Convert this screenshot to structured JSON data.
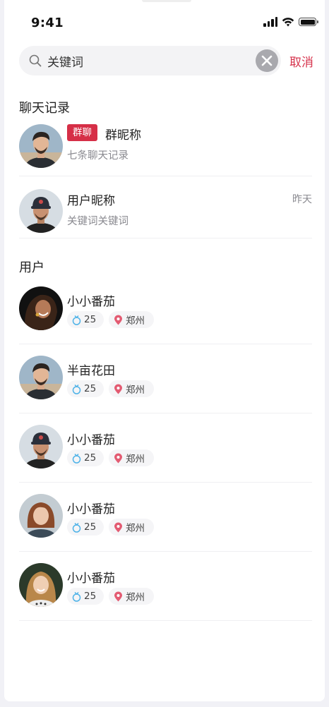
{
  "status_bar": {
    "time": "9:41"
  },
  "search": {
    "value": "关键词",
    "cancel_label": "取消"
  },
  "chat_section": {
    "title": "聊天记录",
    "items": [
      {
        "tag": "群聊",
        "name": "群昵称",
        "subtitle": "七条聊天记录",
        "time": ""
      },
      {
        "tag": "",
        "name": "用户昵称",
        "subtitle": "关键词关键词",
        "time": "昨天"
      }
    ]
  },
  "user_section": {
    "title": "用户",
    "items": [
      {
        "name": "小小番茄",
        "age": "25",
        "city": "郑州"
      },
      {
        "name": "半亩花田",
        "age": "25",
        "city": "郑州"
      },
      {
        "name": "小小番茄",
        "age": "25",
        "city": "郑州"
      },
      {
        "name": "小小番茄",
        "age": "25",
        "city": "郑州"
      },
      {
        "name": "小小番茄",
        "age": "25",
        "city": "郑州"
      }
    ]
  },
  "colors": {
    "accent": "#d6334c",
    "tag_bg": "#d62f47",
    "age_icon": "#4fb3e8",
    "location_icon": "#e35b72"
  },
  "icons": {
    "search": "search-icon",
    "clear": "clear-icon",
    "age": "ring-icon",
    "location": "location-pin-icon"
  }
}
